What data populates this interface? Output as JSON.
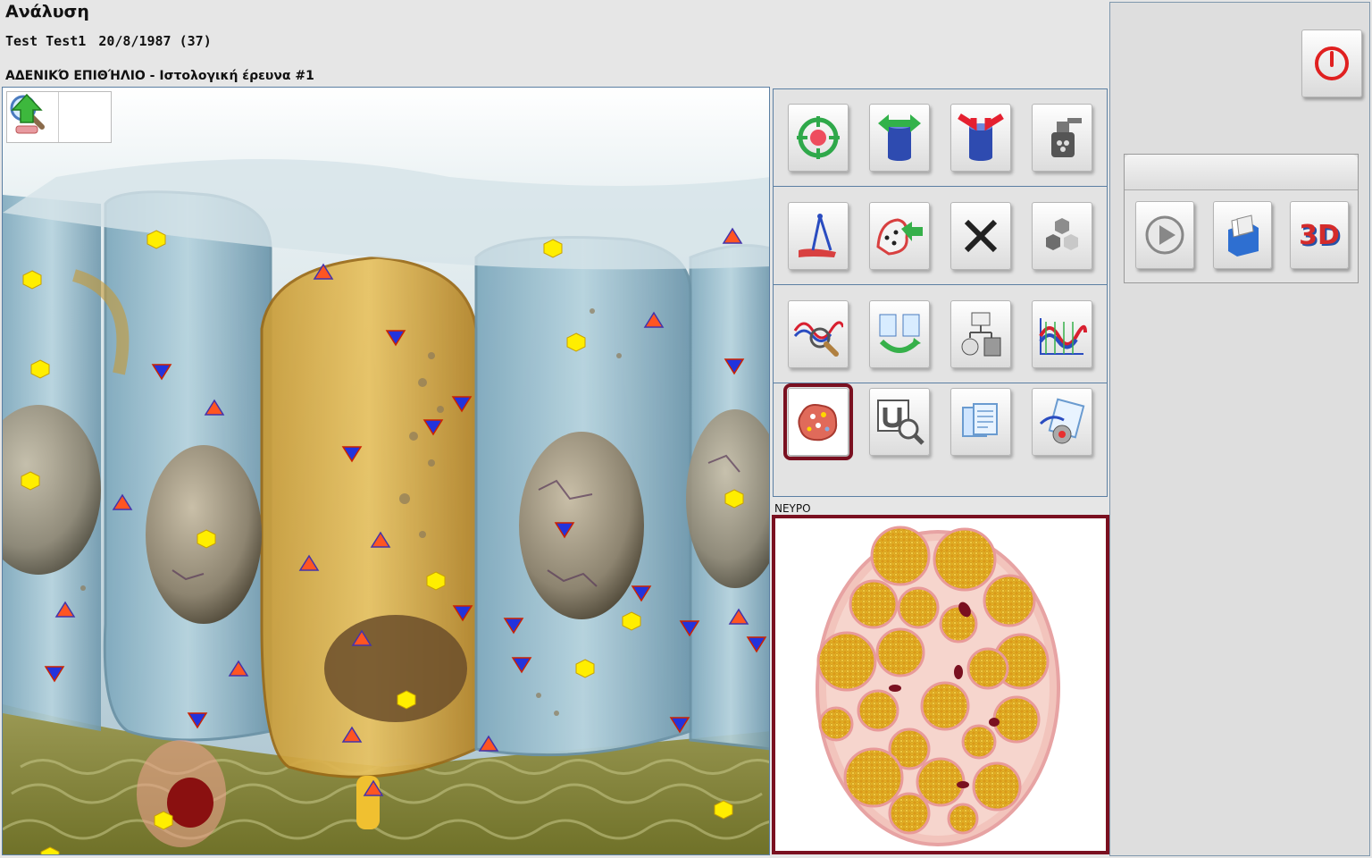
{
  "header": {
    "title": "Ανάλυση",
    "patient_name": "Test  Test1",
    "patient_dob_age": "20/8/1987 (37)",
    "section_title": "ΑΔΕΝΙΚΌ ΕΠΙΘΉΛΙΟ - Ιστολογική έρευνα #1"
  },
  "viewer": {
    "image": "glandular-epithelium-histology-illustration",
    "tools": [
      "zoom-in-icon",
      "export-up-icon"
    ]
  },
  "tools": {
    "row1": [
      "target-icon",
      "cylinder-expand-icon",
      "cylinder-compress-icon",
      "sprayer-icon"
    ],
    "row2": [
      "caliper-icon",
      "cell-transfer-icon",
      "close-x-icon",
      "hexagons-icon"
    ],
    "row3": [
      "wave-magnifier-icon",
      "cycle-documents-icon",
      "network-diagram-icon",
      "spectrum-chart-icon"
    ],
    "row4": [
      "tissue-sample-icon",
      "magnet-scan-icon",
      "documents-icon",
      "analysis-report-icon"
    ],
    "active": "tissue-sample-icon"
  },
  "preview": {
    "label": "ΝΕΥΡΟ",
    "image": "nerve-cross-section"
  },
  "right_panel": {
    "power": "power-icon",
    "buttons": [
      "play-icon",
      "database-icon",
      "3d-icon"
    ],
    "three_d_label": "3D"
  },
  "colors": {
    "accent_border": "#7a1020",
    "panel_border": "#5b7fa3",
    "marker_yellow": "#ffee00",
    "marker_blue": "#2233dd",
    "marker_orange": "#ff5522"
  }
}
